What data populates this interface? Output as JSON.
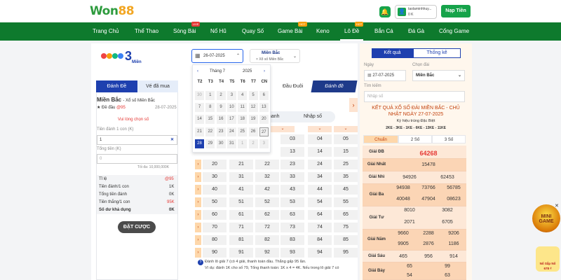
{
  "header": {
    "logo_won": "Won",
    "logo_num": "88",
    "username": "taolaminhhuy...",
    "balance": "0 K",
    "deposit_label": "Nạp Tiền"
  },
  "nav": [
    {
      "label": "Trang Chủ",
      "badge": ""
    },
    {
      "label": "Thể Thao",
      "badge": ""
    },
    {
      "label": "Sòng Bài",
      "badge": "LIVE"
    },
    {
      "label": "Nổ Hũ",
      "badge": ""
    },
    {
      "label": "Quay Số",
      "badge": ""
    },
    {
      "label": "Game Bài",
      "badge": "HOT"
    },
    {
      "label": "Keno",
      "badge": ""
    },
    {
      "label": "Lô Đề",
      "badge": "HOT"
    },
    {
      "label": "Bắn Cá",
      "badge": ""
    },
    {
      "label": "Đá Gà",
      "badge": ""
    },
    {
      "label": "Cổng Game",
      "badge": ""
    }
  ],
  "game": {
    "logo_text": "Miền",
    "date": "26-07-2025",
    "region_title": "Miền Bắc",
    "region_sub": "Xổ số Miền Bắc"
  },
  "calendar": {
    "month": "Tháng 7",
    "year": "2025",
    "weekdays": [
      "T2",
      "T3",
      "T4",
      "T5",
      "T6",
      "T7",
      "CN"
    ],
    "weeks": [
      [
        "30",
        "1",
        "2",
        "3",
        "4",
        "5",
        "6"
      ],
      [
        "7",
        "8",
        "9",
        "10",
        "11",
        "12",
        "13"
      ],
      [
        "14",
        "15",
        "16",
        "17",
        "18",
        "19",
        "20"
      ],
      [
        "21",
        "22",
        "23",
        "24",
        "25",
        "26",
        "27"
      ],
      [
        "28",
        "29",
        "30",
        "31",
        "1",
        "2",
        "3"
      ]
    ]
  },
  "left": {
    "tab_active": "Đánh Đề",
    "tab_other": "Vé đã mua",
    "region": "Miền Bắc",
    "region_sub": "- Xổ số Miền Bắc",
    "bet_type": "★ Đề đầu",
    "bet_rate": "@95",
    "bet_date": "28-07-2025",
    "prompt": "Vui lòng chọn số",
    "per_unit_label": "Tiền đánh 1 con (K)",
    "per_unit_value": "1",
    "total_label": "Tổng tiền (K)",
    "total_value": "0",
    "max_note": "Tối đa: 10,000,000K",
    "summary": [
      {
        "k": "Tỉ lệ",
        "v": "@95",
        "red": true
      },
      {
        "k": "Tiền đánh/1 con",
        "v": "1K",
        "red": false
      },
      {
        "k": "Tổng tiền đánh",
        "v": "0K",
        "red": false
      },
      {
        "k": "Tiền thắng/1 con",
        "v": "95K",
        "red": true
      },
      {
        "k": "Số dư khả dụng",
        "v": "0K",
        "red": false
      }
    ],
    "bet_button": "ĐẶT CƯỢC"
  },
  "grid": {
    "tab_dau_duoi": "Đầu Đuôi",
    "tab_danh_de": "Đánh đề",
    "subtab_1": "hanh",
    "subtab_2": "Nhập số",
    "rows": [
      [
        "03",
        "04",
        "05"
      ],
      [
        "13",
        "14",
        "15"
      ],
      [
        "20",
        "21",
        "22",
        "23",
        "24",
        "25"
      ],
      [
        "30",
        "31",
        "32",
        "33",
        "34",
        "35"
      ],
      [
        "40",
        "41",
        "42",
        "43",
        "44",
        "45"
      ],
      [
        "50",
        "51",
        "52",
        "53",
        "54",
        "55"
      ],
      [
        "60",
        "61",
        "62",
        "63",
        "64",
        "65"
      ],
      [
        "70",
        "71",
        "72",
        "73",
        "74",
        "75"
      ],
      [
        "80",
        "81",
        "82",
        "83",
        "84",
        "85"
      ],
      [
        "90",
        "91",
        "92",
        "93",
        "94",
        "95"
      ]
    ],
    "note1": "Đánh lô giải 7 (có 4 giải, thanh toán đầu. Thắng gấp 95 lần.",
    "note2": "Ví dụ: đánh 1K cho số 79, Tổng thanh toán: 1K x 4 = 4K. Nếu trong lô giải 7 có"
  },
  "right": {
    "tab_active": "Kết quả",
    "tab_other": "Thống kê",
    "date_label": "Ngày",
    "date_value": "27-07-2025",
    "region_label": "Chọn đài",
    "region_value": "Miền Bắc",
    "search_label": "Tìm kiếm",
    "search_placeholder": "Nhập số",
    "title": "KẾT QUẢ XỔ SỐ ĐÀI MIỀN BẮC - CHỦ NHẬT NGÀY 27-07-2025",
    "symbol_label": "Ký hiệu trúng Đặc Biệt",
    "symbol_codes": "2KE - 3KE - 1KE - 6KE - 13KE - 11KE",
    "seg": [
      "Chuẩn",
      "2 Số",
      "3 Số"
    ],
    "results": [
      {
        "label": "Giải ĐB",
        "values": [
          "64268"
        ]
      },
      {
        "label": "Giải Nhất",
        "values": [
          "15478"
        ]
      },
      {
        "label": "Giải Nhì",
        "values": [
          "94926",
          "62453"
        ]
      },
      {
        "label": "Giải Ba",
        "values": [
          "94938",
          "73766",
          "56785",
          "40048",
          "47904",
          "08623"
        ]
      },
      {
        "label": "Giải Tư",
        "values": [
          "8010",
          "3082",
          "2071",
          "6705"
        ]
      },
      {
        "label": "Giải Năm",
        "values": [
          "9660",
          "2288",
          "9206",
          "9905",
          "2876",
          "1186"
        ]
      },
      {
        "label": "Giải Sáu",
        "values": [
          "465",
          "956",
          "914"
        ]
      },
      {
        "label": "Giải Bảy",
        "values": [
          "65",
          "99",
          "54",
          "63"
        ]
      }
    ]
  },
  "promo": {
    "game_text": "MINI GAME",
    "jackpot_label": "Nổ Sắp Nổ",
    "jackpot_value": "678 ₫"
  },
  "colors": {
    "brand_green": "#0e7a2d",
    "accent_blue": "#1e40af",
    "orange": "#c2410c"
  }
}
